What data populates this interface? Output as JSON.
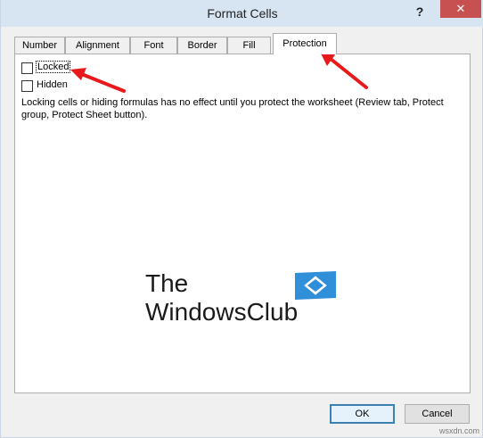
{
  "window": {
    "title": "Format Cells",
    "help_label": "?",
    "close_label": "✕"
  },
  "tabs": [
    {
      "label": "Number",
      "active": false
    },
    {
      "label": "Alignment",
      "active": false
    },
    {
      "label": "Font",
      "active": false
    },
    {
      "label": "Border",
      "active": false
    },
    {
      "label": "Fill",
      "active": false
    },
    {
      "label": "Protection",
      "active": true
    }
  ],
  "protection": {
    "locked": {
      "label": "Locked",
      "checked": false
    },
    "hidden": {
      "label": "Hidden",
      "checked": false
    },
    "description": "Locking cells or hiding formulas has no effect until you protect the worksheet (Review tab, Protect group, Protect Sheet button)."
  },
  "watermark": {
    "line1": "The",
    "line2": "WindowsClub"
  },
  "buttons": {
    "ok": "OK",
    "cancel": "Cancel"
  },
  "source_label": "wsxdn.com",
  "colors": {
    "annotation_arrow": "#e8191b",
    "title_bar": "#d7e4f2",
    "close_button": "#c75050",
    "logo_blue": "#2f8fd8"
  }
}
